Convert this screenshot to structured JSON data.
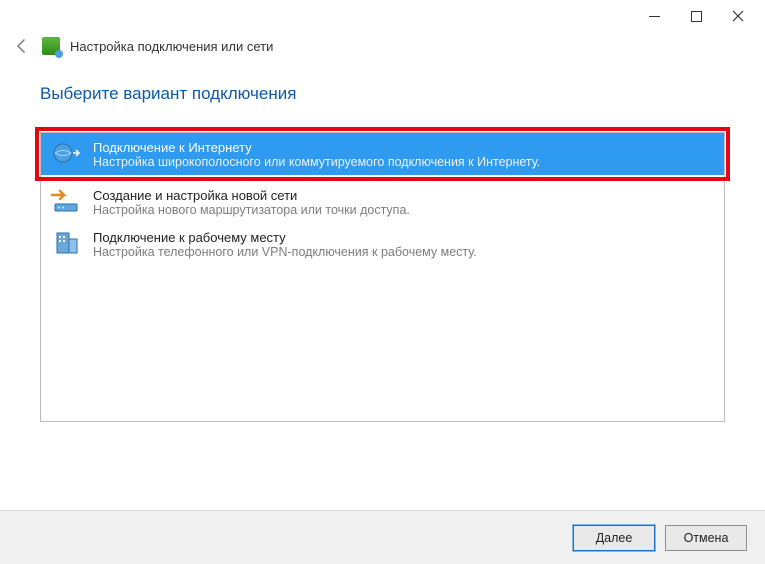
{
  "window": {
    "title": "Настройка подключения или сети"
  },
  "page": {
    "heading": "Выберите вариант подключения"
  },
  "options": [
    {
      "title": "Подключение к Интернету",
      "desc": "Настройка широкополосного или коммутируемого подключения к Интернету.",
      "selected": true
    },
    {
      "title": "Создание и настройка новой сети",
      "desc": "Настройка нового маршрутизатора или точки доступа.",
      "selected": false
    },
    {
      "title": "Подключение к рабочему месту",
      "desc": "Настройка телефонного или VPN-подключения к рабочему месту.",
      "selected": false
    }
  ],
  "footer": {
    "next": "Далее",
    "cancel": "Отмена"
  }
}
